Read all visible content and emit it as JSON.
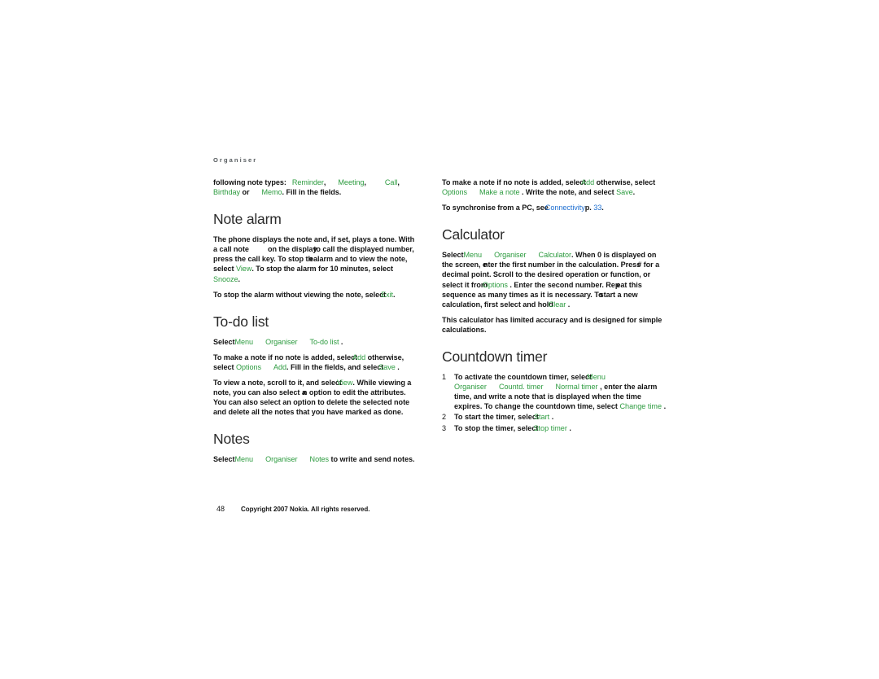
{
  "document": {
    "running_head": "Organiser",
    "page_number": "48",
    "copyright": "Copyright  2007 Nokia. All rights reserved."
  },
  "left_column": {
    "intro": {
      "lead": "following note types:",
      "types": [
        "Reminder",
        "Meeting",
        "Call",
        "Birthday",
        "Memo"
      ],
      "sep_comma": ",",
      "sep_or": "or",
      "tail": ". Fill in the fields."
    },
    "note_alarm": {
      "heading": "Note alarm",
      "p1_a": "The phone displays the note and, if set, plays a tone. With a call note",
      "p1_b": "on the display",
      "p1_c": "to call the displayed number, press the call key. To stop th",
      "p1_d": "e",
      "p1_e": "alarm and to view the note, select",
      "p1_view": "View",
      "p1_f": ". To stop the alarm for 10 minutes, select",
      "p1_snooze": "Snooze",
      "p1_g": ".",
      "p2_a": "To stop the alarm without viewing the note, select",
      "p2_exit": "Exit",
      "p2_b": "."
    },
    "todo_list": {
      "heading": "To-do list",
      "select_label": "Select",
      "path": [
        "Menu",
        "Organiser",
        "To-do list"
      ],
      "path_tail": ".",
      "p2_a": "To make a note if no note is added, select",
      "p2_add": "Add",
      "p2_b": "otherwise, select",
      "p2_options": "Options",
      "p2_add2": "Add",
      "p2_c": ". Fill in the fields, and select",
      "p2_save": "Save",
      "p2_d": ".",
      "p3_a": "To view a note, scroll to it, and select",
      "p3_view": "View",
      "p3_b": ". While viewing a note, you can also select a",
      "p3_c": "n option to edit the attributes. You can also select an option to delete the selected note and delete all the notes that you have marked as done."
    },
    "notes": {
      "heading": "Notes",
      "select_label": "Select",
      "path": [
        "Menu",
        "Organiser",
        "Notes"
      ],
      "tail": "to write and send notes."
    }
  },
  "right_column": {
    "make_note": {
      "p1_a": "To make a note if no note is added, select",
      "p1_add": "Add",
      "p1_b": "otherwise, select",
      "p1_options": "Options",
      "p1_make": "Make a note",
      "p1_c": ". Write the note, and select",
      "p1_save": "Save",
      "p1_d": ".",
      "p2_a": "To synchronise from a PC, see",
      "p2_link": "Connectivity",
      "p2_b": "p.",
      "p2_pageref": "33",
      "p2_c": "."
    },
    "calculator": {
      "heading": "Calculator",
      "select_label": "Select",
      "path": [
        "Menu",
        "Organiser",
        "Calculator"
      ],
      "p1_a": ". When 0 is displayed on the screen, e",
      "p1_b": "nter the first number in the calculation. Press",
      "p1_c": "#",
      "p1_d": "for a decimal point. Scroll to the desired operation or function, or select it from",
      "p1_options": "Options",
      "p1_e": ". Enter the second number. Rep",
      "p1_f": "eat this sequence as many times as it is necessary. To",
      "p1_g": "start a new calculation, first select and hold",
      "p1_clear": "Clear",
      "p1_h": ".",
      "p2": "This calculator has limited accuracy and is designed for simple calculations."
    },
    "countdown_timer": {
      "heading": "Countdown timer",
      "steps": [
        {
          "marker": "1",
          "a": "To activate the countdown timer, select",
          "menu": "Menu",
          "path": [
            "Organiser",
            "Countd. timer",
            "Normal timer"
          ],
          "b": ", enter the alarm time, and write a note that is displayed when the time expires. To change the countdown time, select",
          "change": "Change time",
          "c": "."
        },
        {
          "marker": "2",
          "a": "To start the timer, select",
          "action": "Start",
          "c": "."
        },
        {
          "marker": "3",
          "a": "To stop the timer, select",
          "action": "Stop timer",
          "c": "."
        }
      ]
    }
  },
  "colors": {
    "ui_term_green": "#2c9b3f",
    "link_blue": "#1f6fd0",
    "heading_gray": "#2a2a2a",
    "body_black": "#141414",
    "running_head_gray": "#555a5d"
  }
}
